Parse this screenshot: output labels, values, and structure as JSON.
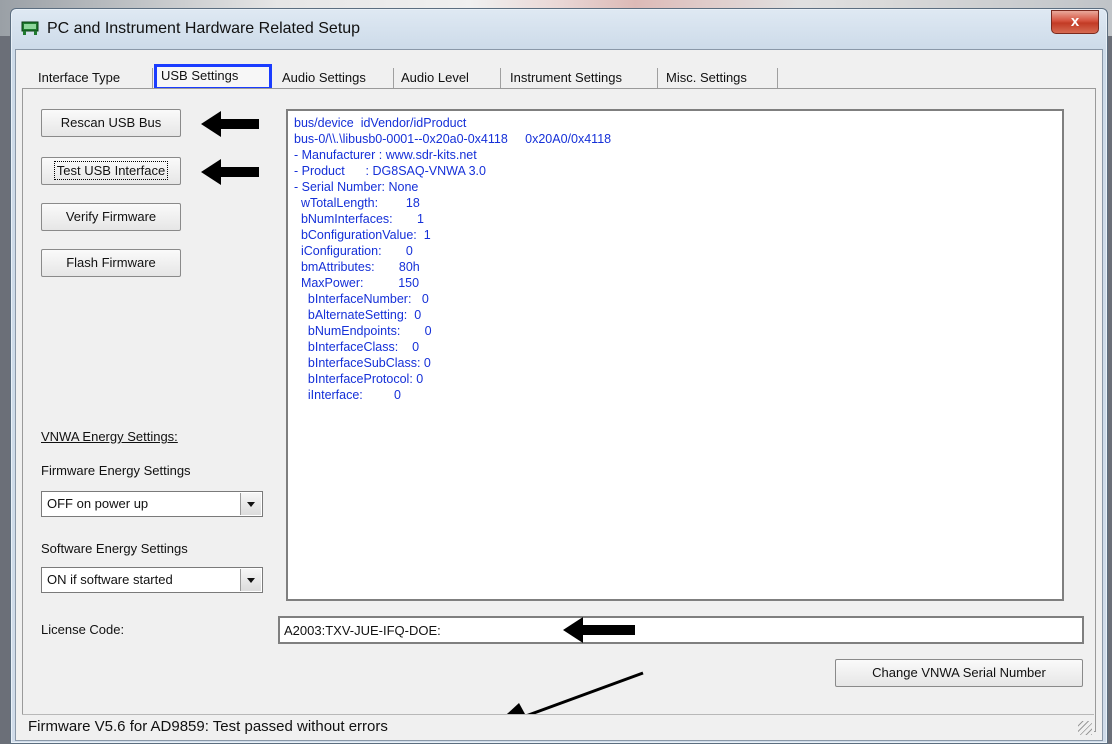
{
  "window": {
    "title": "PC and Instrument Hardware Related Setup",
    "close_glyph": "x"
  },
  "tabs": [
    {
      "label": "Interface Type"
    },
    {
      "label": "USB Settings"
    },
    {
      "label": "Audio Settings"
    },
    {
      "label": "Audio Level"
    },
    {
      "label": "Instrument Settings"
    },
    {
      "label": "Misc. Settings"
    }
  ],
  "active_tab": "USB Settings",
  "buttons": {
    "rescan": "Rescan USB Bus",
    "test": "Test USB Interface",
    "verify": "Verify Firmware",
    "flash": "Flash Firmware",
    "change_serial": "Change VNWA Serial Number"
  },
  "usb_info_lines": [
    "bus/device  idVendor/idProduct",
    "bus-0/\\\\.\\libusb0-0001--0x20a0-0x4118     0x20A0/0x4118",
    "- Manufacturer : www.sdr-kits.net",
    "- Product      : DG8SAQ-VNWA 3.0",
    "- Serial Number: None",
    "  wTotalLength:        18",
    "  bNumInterfaces:       1",
    "  bConfigurationValue:  1",
    "  iConfiguration:       0",
    "  bmAttributes:       80h",
    "  MaxPower:          150",
    "    bInterfaceNumber:   0",
    "    bAlternateSetting:  0",
    "    bNumEndpoints:       0",
    "    bInterfaceClass:    0",
    "    bInterfaceSubClass: 0",
    "    bInterfaceProtocol: 0",
    "    iInterface:         0"
  ],
  "energy": {
    "heading": "VNWA Energy Settings:",
    "firmware_label": "Firmware Energy Settings",
    "firmware_value": "OFF on power up",
    "software_label": "Software Energy Settings",
    "software_value": "ON if software started"
  },
  "license": {
    "label": "License Code:",
    "value": "A2003:TXV-JUE-IFQ-DOE:"
  },
  "status": {
    "text": "Firmware V5.6 for AD9859:  Test passed without errors"
  },
  "colors": {
    "usb_text": "#1530d8",
    "tab_highlight": "#1a3cff",
    "annotation_arrows": "#000000"
  }
}
